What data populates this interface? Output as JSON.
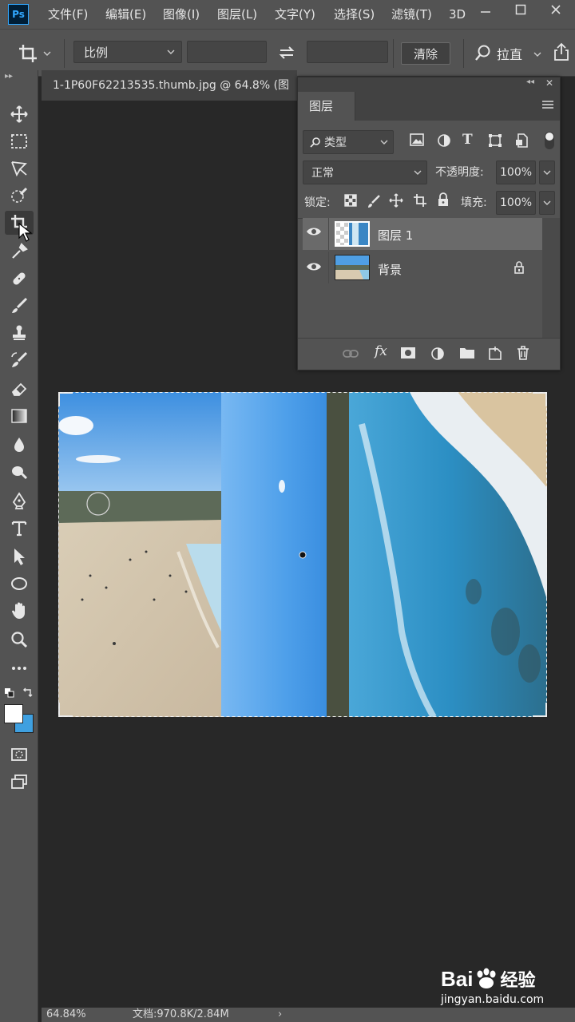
{
  "menubar": {
    "app_icon": "Ps",
    "items": [
      "文件(F)",
      "编辑(E)",
      "图像(I)",
      "图层(L)",
      "文字(Y)",
      "选择(S)",
      "滤镜(T)",
      "3D"
    ],
    "window_controls": [
      "minimize-icon",
      "maximize-icon",
      "close-icon"
    ]
  },
  "options_bar": {
    "ratio_label": "比例",
    "clear_label": "清除",
    "straighten_label": "拉直"
  },
  "document": {
    "tab_title": "1-1P60F62213535.thumb.jpg @ 64.8% (图"
  },
  "layers_panel": {
    "title": "图层",
    "filter_label": "类型",
    "blend_mode": "正常",
    "opacity_label": "不透明度:",
    "opacity_value": "100%",
    "lock_label": "锁定:",
    "fill_label": "填充:",
    "fill_value": "100%",
    "layers": [
      {
        "name": "图层 1",
        "visible": true,
        "selected": true,
        "locked": false
      },
      {
        "name": "背景",
        "visible": true,
        "selected": false,
        "locked": true
      }
    ],
    "footer_icons": [
      "link-icon",
      "fx-icon",
      "mask-icon",
      "adjustment-icon",
      "folder-icon",
      "new-layer-icon",
      "trash-icon"
    ]
  },
  "status_bar": {
    "zoom": "64.84%",
    "doc_info": "文档:970.8K/2.84M"
  },
  "watermark": {
    "brand": "Bai",
    "brand_cn": "经验",
    "url": "jingyan.baidu.com"
  },
  "colors": {
    "ui_dark": "#282828",
    "ui_panel": "#535353",
    "ps_blue": "#31a8ff",
    "background_swatch": "#3fa0e0",
    "foreground_swatch": "#ffffff"
  }
}
